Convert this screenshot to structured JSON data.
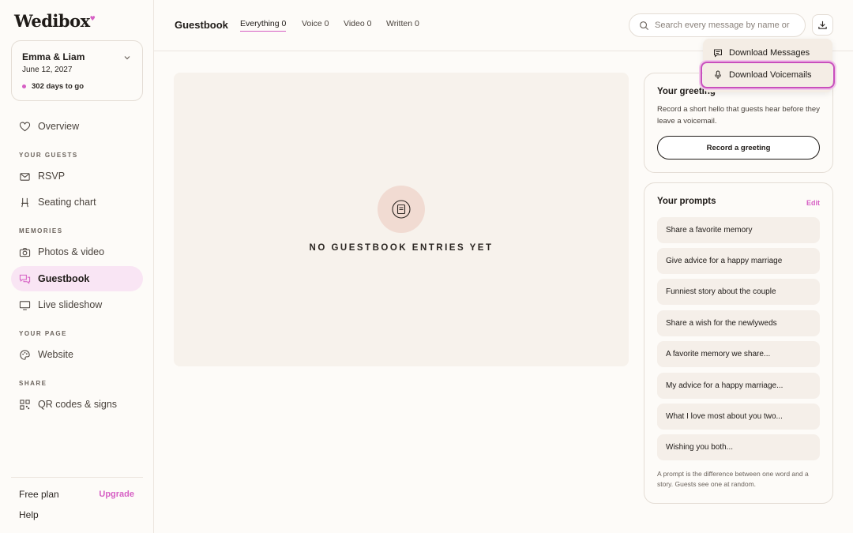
{
  "app": {
    "logo": "Wedibox"
  },
  "event": {
    "name": "Emma & Liam",
    "date": "June 12, 2027",
    "countdown": "302 days to go"
  },
  "sidebar": {
    "overview": "Overview",
    "sections": {
      "guests": "YOUR GUESTS",
      "memories": "MEMORIES",
      "page": "YOUR PAGE",
      "share": "SHARE"
    },
    "items": {
      "rsvp": "RSVP",
      "seating": "Seating chart",
      "photos": "Photos & video",
      "guestbook": "Guestbook",
      "slideshow": "Live slideshow",
      "website": "Website",
      "qr": "QR codes & signs"
    },
    "plan": "Free plan",
    "upgrade": "Upgrade",
    "help": "Help"
  },
  "header": {
    "title": "Guestbook",
    "tabs": [
      {
        "label": "Everything 0",
        "active": true
      },
      {
        "label": "Voice 0",
        "active": false
      },
      {
        "label": "Video 0",
        "active": false
      },
      {
        "label": "Written 0",
        "active": false
      }
    ],
    "search_placeholder": "Search every message by name or"
  },
  "dropdown": {
    "items": [
      {
        "label": "Download Messages",
        "icon": "message-icon"
      },
      {
        "label": "Download Voicemails",
        "icon": "microphone-icon"
      }
    ]
  },
  "empty_state": {
    "text": "NO GUESTBOOK ENTRIES YET",
    "icon": "guestbook-icon"
  },
  "greeting": {
    "title": "Your greeting",
    "description": "Record a short hello that guests hear before they leave a voicemail.",
    "button": "Record a greeting"
  },
  "prompts": {
    "title": "Your prompts",
    "edit": "Edit",
    "items": [
      "Share a favorite memory",
      "Give advice for a happy marriage",
      "Funniest story about the couple",
      "Share a wish for the newlyweds",
      "A favorite memory we share...",
      "My advice for a happy marriage...",
      "What I love most about you two...",
      "Wishing you both..."
    ],
    "footnote": "A prompt is the difference between one word and a story. Guests see one at random."
  },
  "colors": {
    "accent": "#d65fc4",
    "active_nav_bg": "#f9e5f4",
    "panel_bg": "#f7f2ec",
    "empty_icon_bg": "#f1dbd2"
  }
}
